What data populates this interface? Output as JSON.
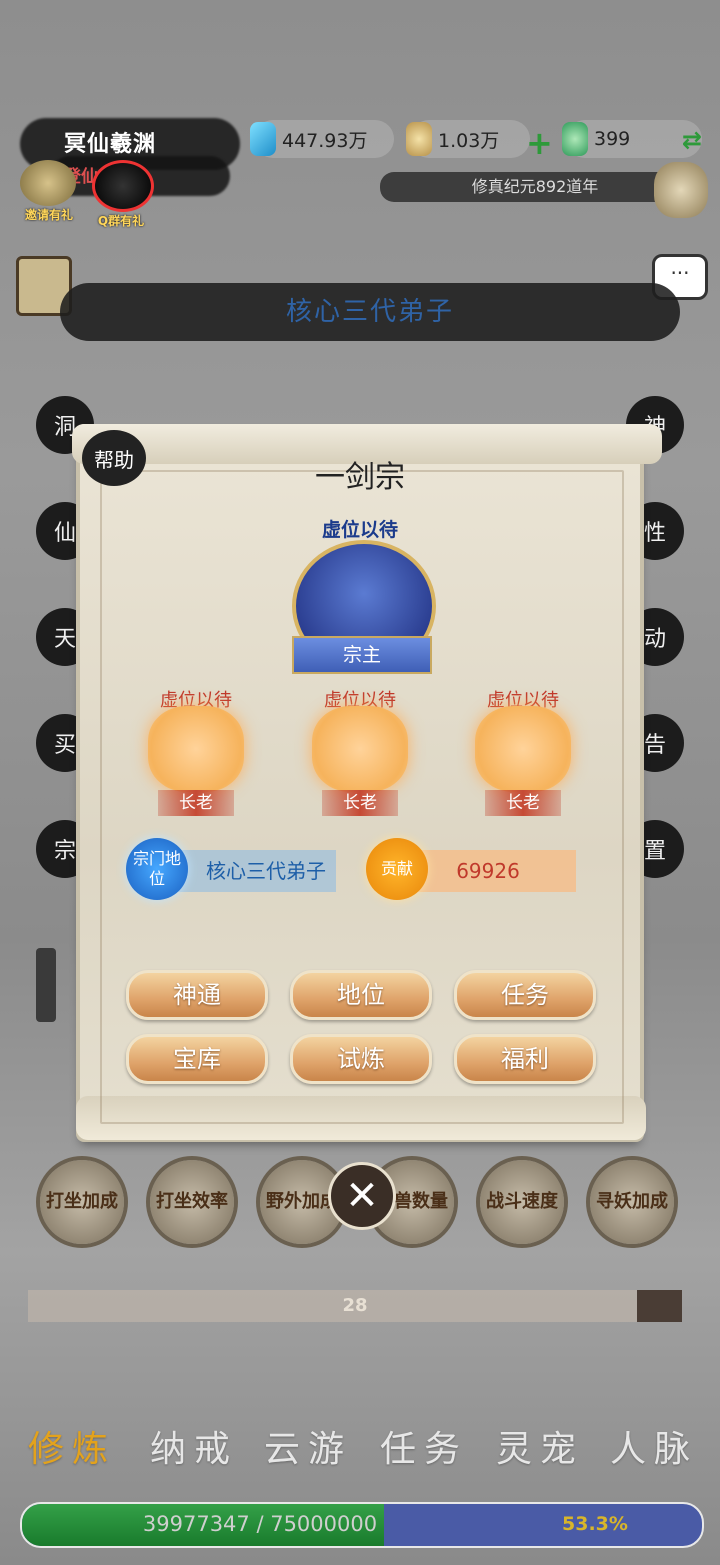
{
  "player": {
    "name": "冥仙羲渊",
    "rank": "登仙"
  },
  "quick_links": {
    "invite": "邀请有礼",
    "qq_group": "Q群有礼"
  },
  "resources": {
    "spirit_stone": "447.93万",
    "gold": "1.03万",
    "jade": "399"
  },
  "era": "修真纪元892道年",
  "sect_title_banner": "核心三代弟子",
  "side_menu_left": [
    "洞",
    "仙",
    "天",
    "买",
    "宗"
  ],
  "side_menu_right": [
    "神",
    "性",
    "动",
    "告",
    "置"
  ],
  "panel": {
    "help": "帮助",
    "sect_name": "一剑宗",
    "leader_status": "虚位以待",
    "leader_title": "宗主",
    "elders": [
      {
        "status": "虚位以待",
        "title": "长老"
      },
      {
        "status": "虚位以待",
        "title": "长老"
      },
      {
        "status": "虚位以待",
        "title": "长老"
      }
    ],
    "position_label": "宗门地位",
    "position_value": "核心三代弟子",
    "contribution_label": "贡献",
    "contribution_value": "69926",
    "buttons": [
      "神通",
      "地位",
      "任务",
      "宝库",
      "试炼",
      "福利"
    ],
    "close_glyph": "✕"
  },
  "bonus_buttons": [
    "打坐加成",
    "打坐效率",
    "野外加成",
    "妖兽数量",
    "战斗速度",
    "寻妖加成"
  ],
  "level_bar": {
    "value": "28"
  },
  "tabs": [
    "修炼",
    "纳戒",
    "云游",
    "任务",
    "灵宠",
    "人脉"
  ],
  "active_tab": "修炼",
  "experience": {
    "text": "39977347 / 75000000",
    "percent": "53.3%",
    "fraction": 0.533
  },
  "colors": {
    "accent": "#e3a21c",
    "sect_blue": "#1b3b8c",
    "contribution_red": "#c0392b"
  }
}
